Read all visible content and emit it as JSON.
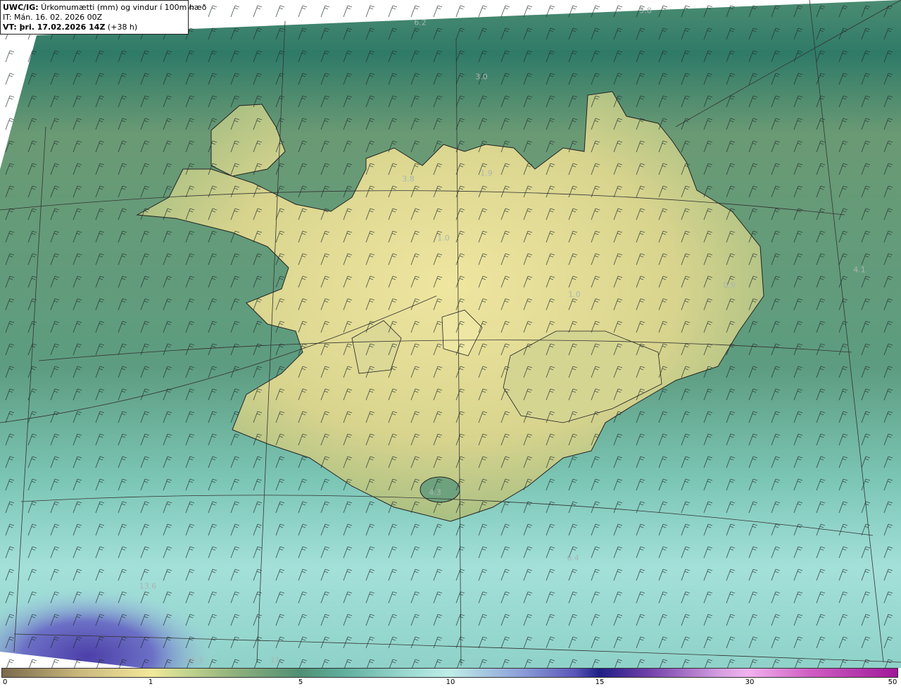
{
  "header": {
    "line1_bold": "UWC/IG:",
    "line1_text": " Úrkomumætti (mm) og vindur í 100m hæð",
    "line2": "IT: Mán. 16. 02. 2026 00Z",
    "line3_bold": "VT: þri. 17.02.2026 14Z",
    "line3_text": " (+38 h)"
  },
  "value_labels": [
    "6.2",
    "5.8",
    "3.0",
    "3.8",
    "1.9",
    "1.0",
    "1.0",
    "0.9",
    "4.1",
    "4.3",
    "6.4",
    "13.6",
    "14.3",
    "11"
  ],
  "colorbar": {
    "ticks": [
      "0",
      "1",
      "5",
      "10",
      "15",
      "30",
      "50"
    ],
    "tick_values": [
      0,
      1,
      5,
      10,
      15,
      30,
      50
    ]
  },
  "colors": {
    "land": "#e7e09a",
    "sea": "#4f8f74",
    "high_precip": "#5a56b8"
  }
}
